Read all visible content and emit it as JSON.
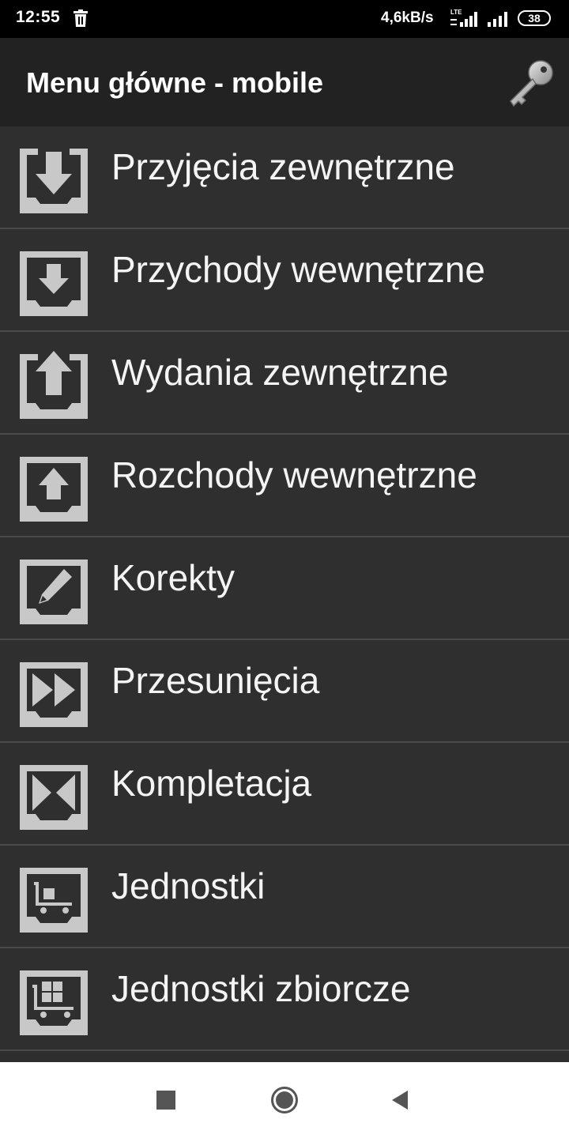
{
  "status": {
    "time": "12:55",
    "net_speed": "4,6kB/s",
    "lte_label": "LTE",
    "battery": "38"
  },
  "app": {
    "title": "Menu główne - mobile"
  },
  "menu": {
    "items": [
      {
        "label": "Przyjęcia zewnętrzne",
        "icon": "inbox-down-icon"
      },
      {
        "label": "Przychody wewnętrzne",
        "icon": "inbox-down-icon"
      },
      {
        "label": "Wydania zewnętrzne",
        "icon": "inbox-up-icon"
      },
      {
        "label": "Rozchody wewnętrzne",
        "icon": "inbox-up-icon"
      },
      {
        "label": "Korekty",
        "icon": "inbox-pencil-icon"
      },
      {
        "label": "Przesunięcia",
        "icon": "inbox-fast-forward-icon"
      },
      {
        "label": "Kompletacja",
        "icon": "inbox-bowtie-icon"
      },
      {
        "label": "Jednostki",
        "icon": "inbox-cart-icon"
      },
      {
        "label": "Jednostki zbiorcze",
        "icon": "inbox-cart-grid-icon"
      }
    ]
  },
  "colors": {
    "background": "#2e2e2e",
    "appbar": "#222222",
    "icon": "#c8c8c8",
    "divider": "#4a4a4a"
  }
}
